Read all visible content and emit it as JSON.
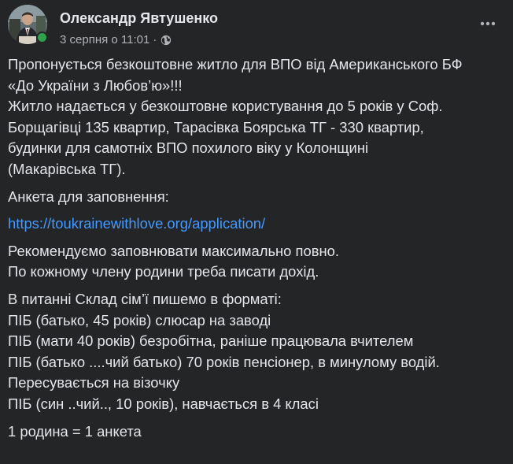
{
  "post": {
    "author": "Олександр Явтушенко",
    "date": "3 серпня о 11:01",
    "separator": "·",
    "privacy_icon": "globe-icon",
    "menu_icon": "more-horizontal-icon",
    "colors": {
      "background": "#242526",
      "text": "#e4e6eb",
      "secondary_text": "#b0b3b8",
      "link": "#4599ff",
      "online": "#31a24c"
    },
    "body": {
      "p1_lines": [
        "Пропонується безкоштовне житло для ВПО від Американського БФ",
        "«До України з Любов’ю»!!!",
        "Житло надається у безкоштовне користування до 5 років у Соф.",
        "Борщагівці 135 квартир, Тарасівка Боярська ТГ - 330 квартир,",
        "будинки для самотніх ВПО похилого віку у Колонщині",
        "(Макарівська ТГ)."
      ],
      "p2": "Анкета для заповнення:",
      "link": "https://toukrainewithlove.org/application/",
      "p3_lines": [
        "Рекомендуємо заповнювати максимально повно.",
        "По кожному члену родини треба писати дохід."
      ],
      "p4_lines": [
        "В питанні Склад сім’ї  пишемо в форматі:",
        "ПІБ (батько, 45 років) слюсар на заводі",
        "ПІБ (мати 40 років) безробітна, раніше працювала вчителем",
        "ПІБ (батько ....чий батько) 70 років пенсіонер, в минулому водій.",
        "Пересувається на візочку",
        "ПІБ (син  ..чий.., 10 років), навчається в 4 класі"
      ],
      "p5": "1 родина = 1 анкета"
    }
  }
}
